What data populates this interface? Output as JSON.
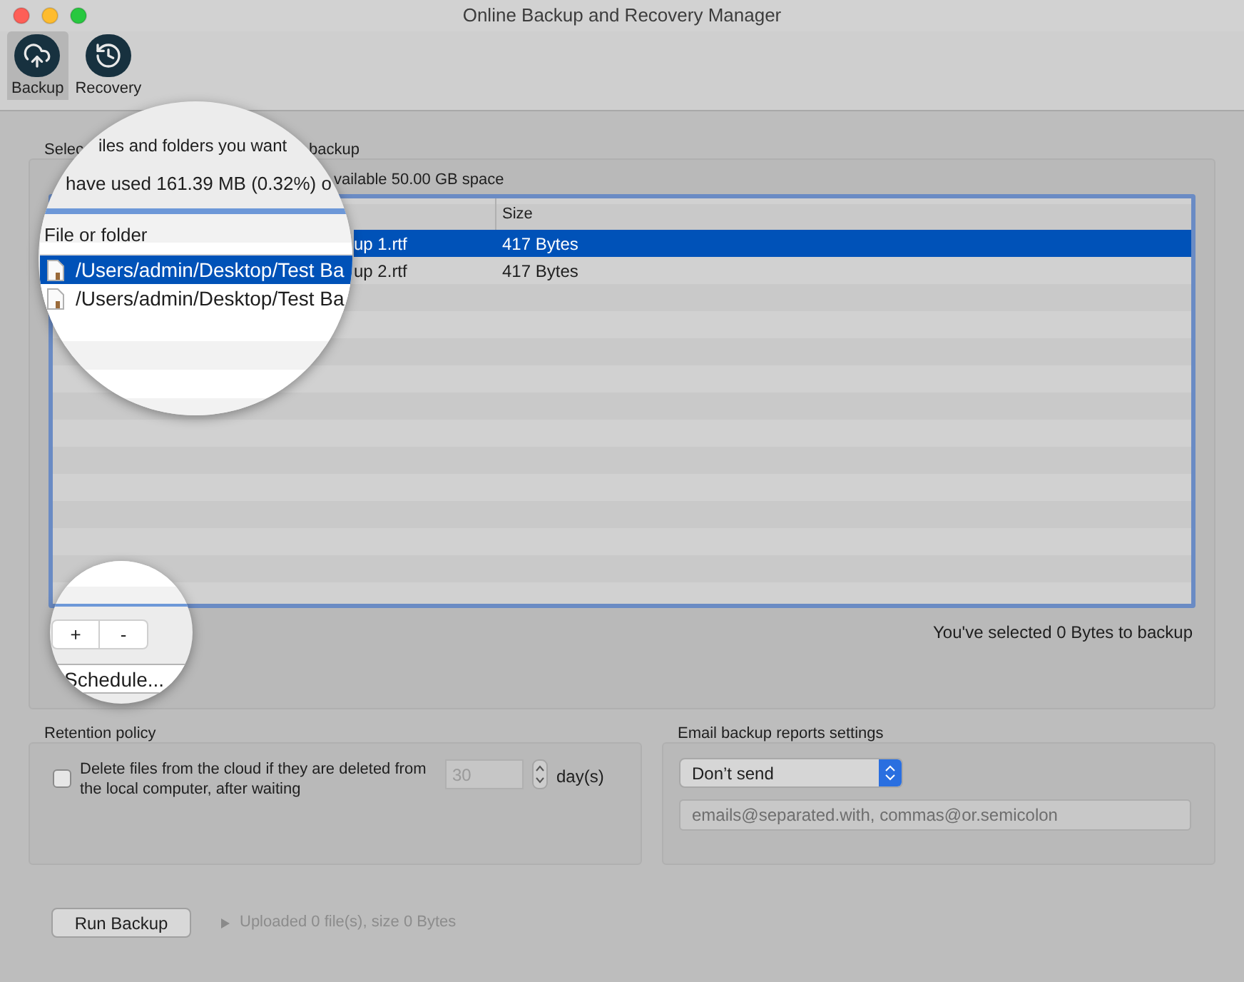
{
  "window": {
    "title": "Online Backup and Recovery Manager"
  },
  "toolbar": [
    {
      "label": "Backup",
      "selected": true
    },
    {
      "label": "Recovery",
      "selected": false
    }
  ],
  "files_group": {
    "label_parts": [
      "Selec",
      "backup"
    ],
    "usage_tail": "vailable 50.00 GB space",
    "columns": [
      "Size"
    ],
    "rows": [
      {
        "name_tail": "up 1.rtf",
        "size": "417 Bytes",
        "selected": true
      },
      {
        "name_tail": "up 2.rtf",
        "size": "417 Bytes",
        "selected": false
      }
    ],
    "selection_summary": "You've selected 0 Bytes to backup"
  },
  "magnifier_top": {
    "label": "iles and folders you want",
    "usage": "have used 161.39 MB (0.32%) o",
    "column": "File or folder",
    "rows": [
      {
        "name": "/Users/admin/Desktop/Test Ba",
        "selected": true
      },
      {
        "name": "/Users/admin/Desktop/Test Ba",
        "selected": false
      }
    ]
  },
  "magnifier_bottom": {
    "buttons": [
      "+",
      "-"
    ],
    "schedule": "Schedule..."
  },
  "retention": {
    "title": "Retention policy",
    "checked": false,
    "label": "Delete files from the cloud if they are deleted from the local computer, after waiting",
    "days": "30",
    "days_disabled": true,
    "unit": "day(s)"
  },
  "email": {
    "title": "Email backup reports settings",
    "select": "Don’t send",
    "placeholder": "emails@separated.with, commas@or.semicolon"
  },
  "footer": {
    "button": "Run Backup",
    "status": "Uploaded 0 file(s), size 0 Bytes",
    "expanded": false
  }
}
